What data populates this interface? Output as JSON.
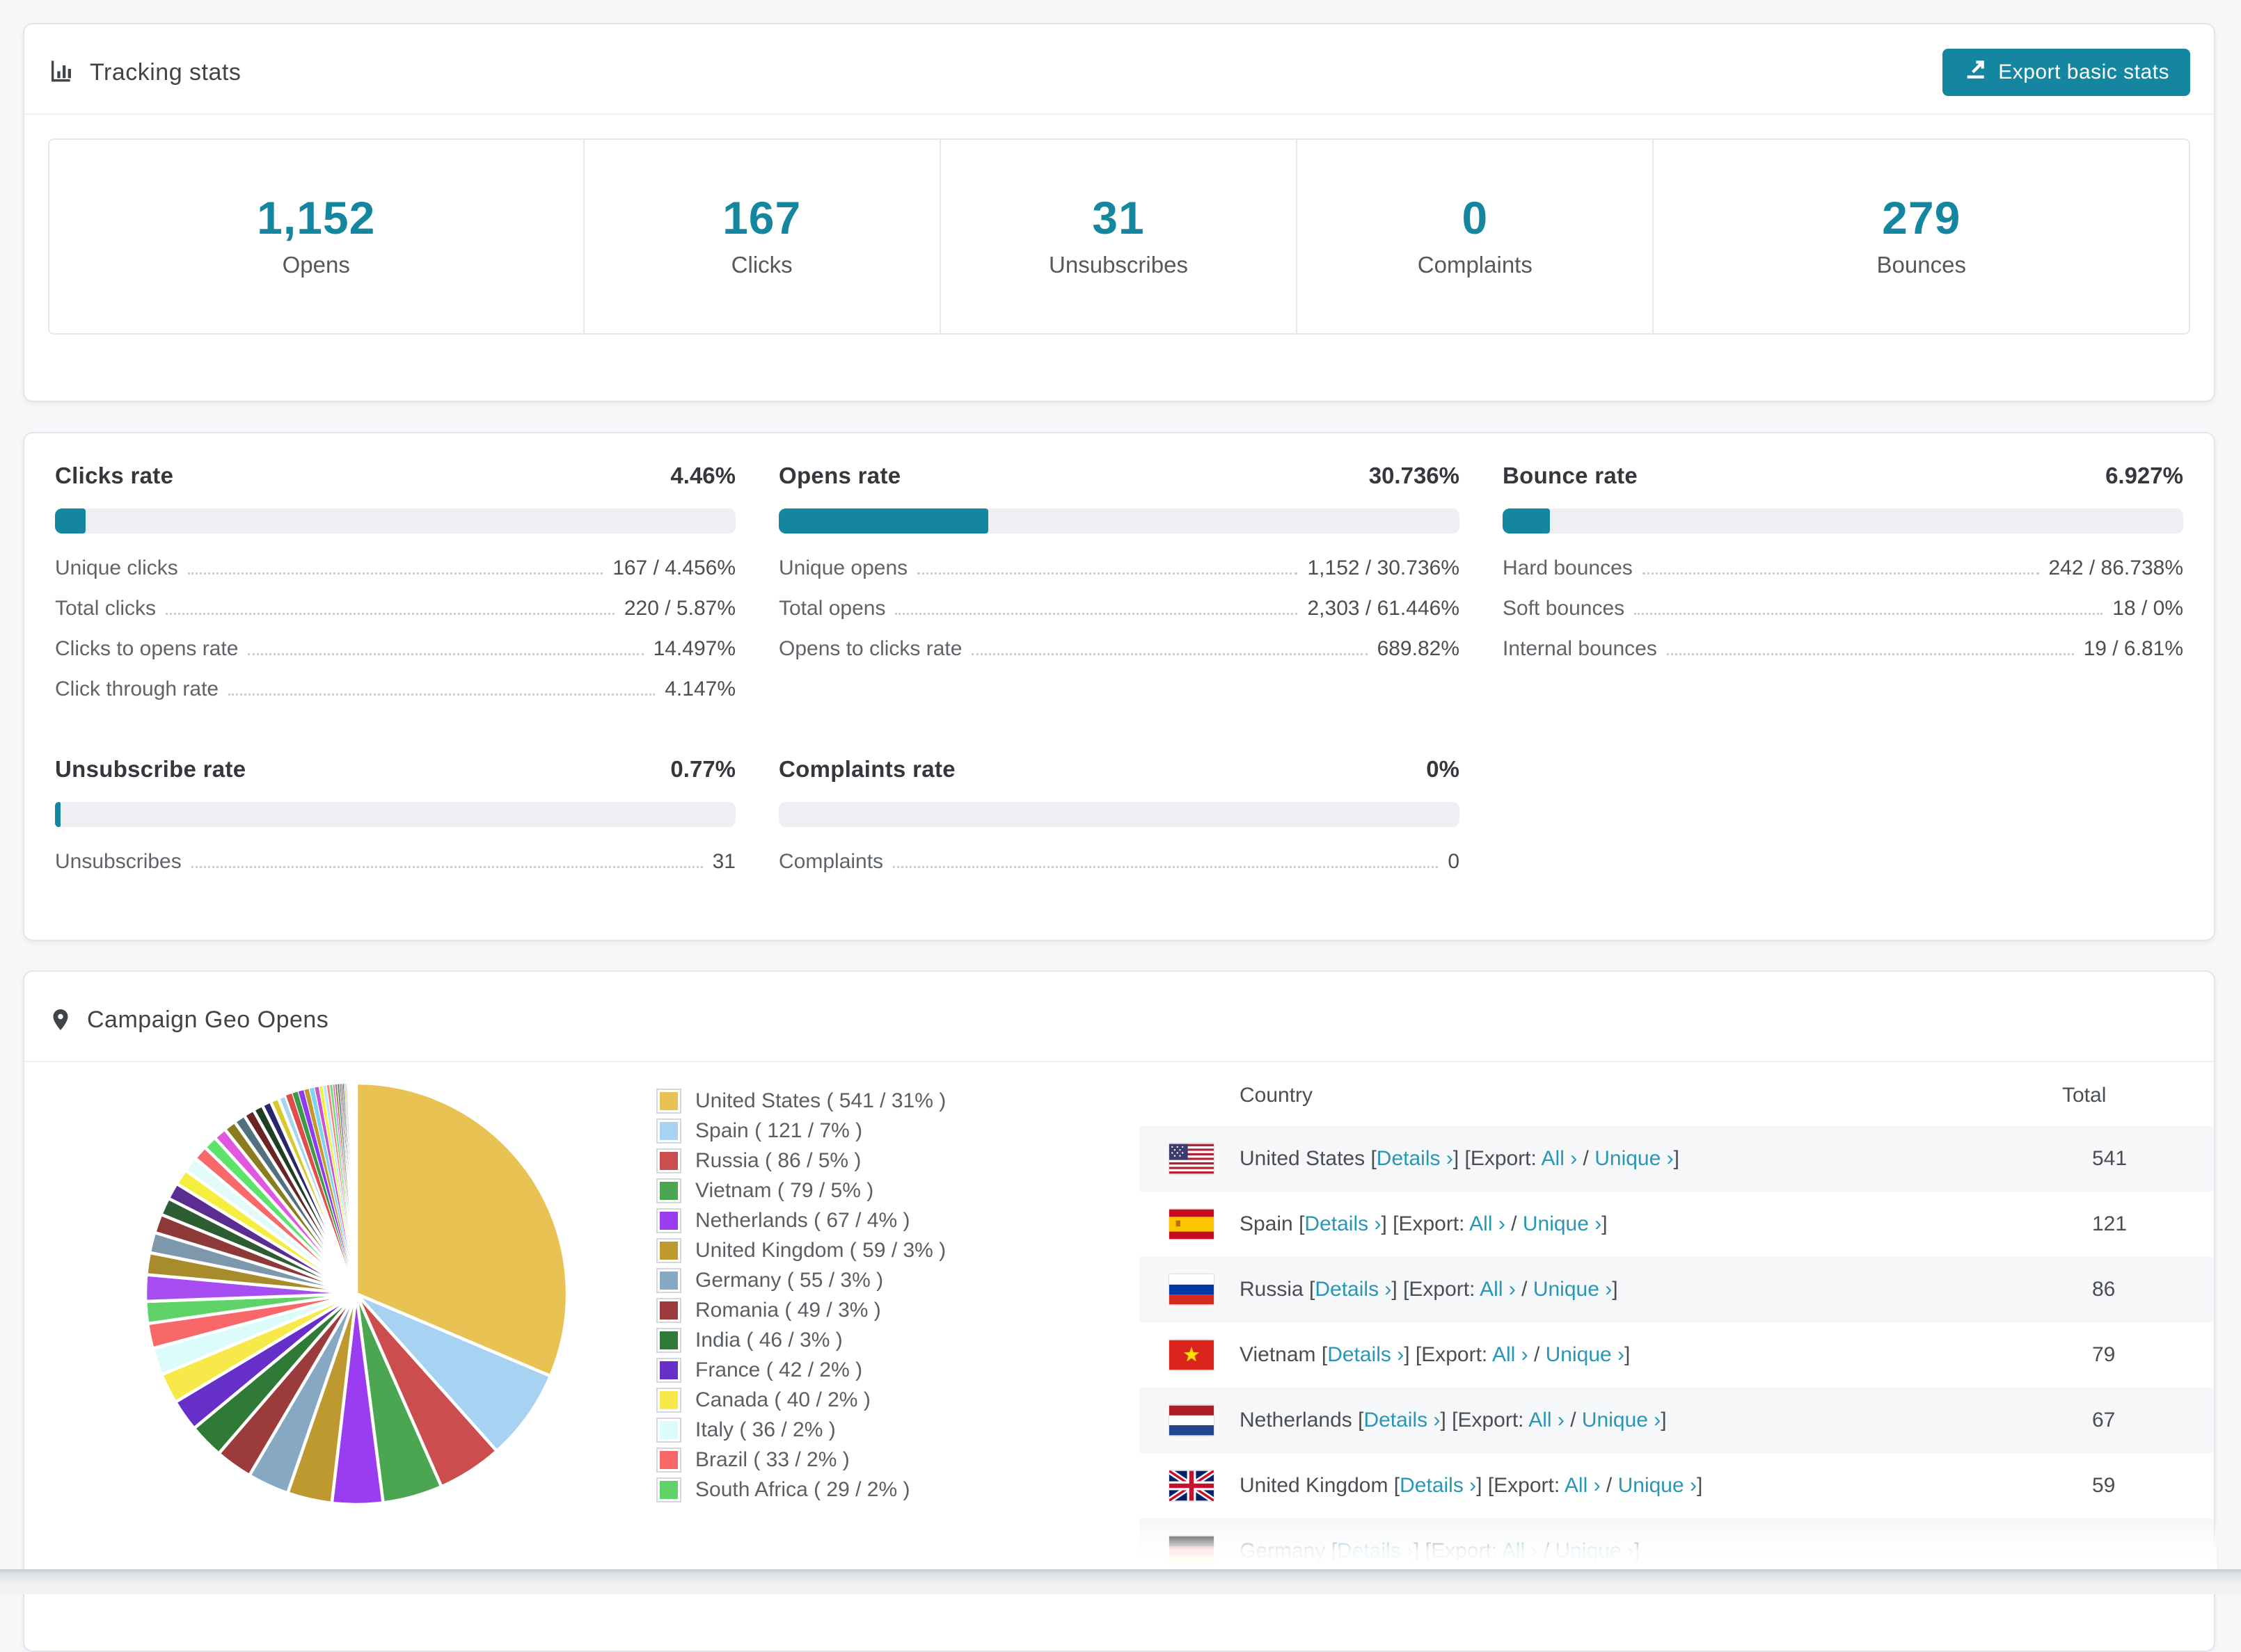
{
  "tracking_card": {
    "title": "Tracking stats",
    "title_icon": "bar-chart-icon",
    "export_button": {
      "label": "Export basic stats",
      "icon": "export-icon",
      "bg": "#1486a0"
    },
    "stats": [
      {
        "value": "1,152",
        "label": "Opens"
      },
      {
        "value": "167",
        "label": "Clicks"
      },
      {
        "value": "31",
        "label": "Unsubscribes"
      },
      {
        "value": "0",
        "label": "Complaints"
      },
      {
        "value": "279",
        "label": "Bounces"
      }
    ]
  },
  "rates_card": {
    "row1": [
      {
        "title": "Clicks rate",
        "value": "4.46%",
        "pct": 4.46,
        "rows": [
          {
            "label": "Unique clicks",
            "value": "167 / 4.456%"
          },
          {
            "label": "Total clicks",
            "value": "220 / 5.87%"
          },
          {
            "label": "Clicks to opens rate",
            "value": "14.497%"
          },
          {
            "label": "Click through rate",
            "value": "4.147%"
          }
        ]
      },
      {
        "title": "Opens rate",
        "value": "30.736%",
        "pct": 30.736,
        "rows": [
          {
            "label": "Unique opens",
            "value": "1,152 / 30.736%"
          },
          {
            "label": "Total opens",
            "value": "2,303 / 61.446%"
          },
          {
            "label": "Opens to clicks rate",
            "value": "689.82%"
          }
        ]
      },
      {
        "title": "Bounce rate",
        "value": "6.927%",
        "pct": 6.927,
        "rows": [
          {
            "label": "Hard bounces",
            "value": "242 / 86.738%"
          },
          {
            "label": "Soft bounces",
            "value": "18 / 0%"
          },
          {
            "label": "Internal bounces",
            "value": "19 / 6.81%"
          }
        ]
      }
    ],
    "row2": [
      {
        "title": "Unsubscribe rate",
        "value": "0.77%",
        "pct": 0.77,
        "rows": [
          {
            "label": "Unsubscribes",
            "value": "31"
          }
        ]
      },
      {
        "title": "Complaints rate",
        "value": "0%",
        "pct": 0,
        "rows": [
          {
            "label": "Complaints",
            "value": "0"
          }
        ]
      }
    ]
  },
  "geo_card": {
    "title": "Campaign Geo Opens",
    "title_icon": "map-pin-icon",
    "table": {
      "headers": {
        "country": "Country",
        "total": "Total"
      },
      "link_details": "Details ›",
      "export_prefix": "Export:",
      "link_all": "All ›",
      "link_unique": "Unique ›",
      "rows": [
        {
          "flag": "us",
          "country": "United States",
          "total": "541"
        },
        {
          "flag": "es",
          "country": "Spain",
          "total": "121"
        },
        {
          "flag": "ru",
          "country": "Russia",
          "total": "86"
        },
        {
          "flag": "vn",
          "country": "Vietnam",
          "total": "79"
        },
        {
          "flag": "nl",
          "country": "Netherlands",
          "total": "67"
        },
        {
          "flag": "gb",
          "country": "United Kingdom",
          "total": "59"
        },
        {
          "flag": "de",
          "country": "Germany",
          "total": "",
          "partial": true
        }
      ]
    }
  },
  "chart_data": {
    "type": "pie",
    "title": "Campaign Geo Opens",
    "legend_position": "right",
    "legend_format": "name ( value / pct )",
    "series": [
      {
        "name": "United States",
        "value": 541,
        "pct": "31%",
        "color": "#e9c254"
      },
      {
        "name": "Spain",
        "value": 121,
        "pct": "7%",
        "color": "#a8d2f2"
      },
      {
        "name": "Russia",
        "value": 86,
        "pct": "5%",
        "color": "#cc4d4d"
      },
      {
        "name": "Vietnam",
        "value": 79,
        "pct": "5%",
        "color": "#4aa650"
      },
      {
        "name": "Netherlands",
        "value": 67,
        "pct": "4%",
        "color": "#9a3df0"
      },
      {
        "name": "United Kingdom",
        "value": 59,
        "pct": "3%",
        "color": "#bd992f"
      },
      {
        "name": "Germany",
        "value": 55,
        "pct": "3%",
        "color": "#87a8c3"
      },
      {
        "name": "Romania",
        "value": 49,
        "pct": "3%",
        "color": "#9c3b3b"
      },
      {
        "name": "India",
        "value": 46,
        "pct": "3%",
        "color": "#2f7a37"
      },
      {
        "name": "France",
        "value": 42,
        "pct": "2%",
        "color": "#6630c8"
      },
      {
        "name": "Canada",
        "value": 40,
        "pct": "2%",
        "color": "#f8e94b"
      },
      {
        "name": "Italy",
        "value": 36,
        "pct": "2%",
        "color": "#dcfcfc"
      },
      {
        "name": "Brazil",
        "value": 33,
        "pct": "2%",
        "color": "#f86868"
      },
      {
        "name": "South Africa",
        "value": 29,
        "pct": "2%",
        "color": "#5fd368"
      }
    ],
    "others_note": "many small unlabeled country slices filling the remainder of the pie",
    "others": {
      "values": [
        35,
        29,
        27,
        25,
        23,
        22,
        21,
        20,
        19,
        18,
        17,
        16,
        15,
        14,
        13,
        12,
        11,
        10,
        9,
        8,
        8,
        7,
        7,
        6,
        5,
        5,
        4,
        4,
        3,
        3,
        3,
        2,
        2,
        2,
        2,
        2,
        1,
        1,
        1,
        1,
        1,
        1,
        1,
        1,
        1,
        1,
        1,
        1
      ],
      "colors": [
        "#a64ef2",
        "#a88b2a",
        "#7d97ad",
        "#8e3939",
        "#2f5d33",
        "#5c2d91",
        "#f6ee3f",
        "#e2fafa",
        "#f86a6a",
        "#5be36a",
        "#e057e0",
        "#8a7d1f",
        "#53707f",
        "#6b2424",
        "#1d3f22",
        "#28276e",
        "#d9c92f",
        "#a9d3ee",
        "#e14b4b",
        "#3f9a46",
        "#8f3bf0",
        "#c2992c",
        "#7fd4f2",
        "#cf4fcf",
        "#f1f13d",
        "#bde9f5",
        "#fb7d7d",
        "#68e373",
        "#e96ae9",
        "#948422",
        "#5d7a88",
        "#79302f",
        "#274c2a",
        "#332e7d",
        "#cbb92e",
        "#98c8ea",
        "#d84545",
        "#51a957",
        "#9b54ef",
        "#b08d2c",
        "#86b6d9",
        "#c04a4a",
        "#3b8f41",
        "#7c3bd4",
        "#e3d43a"
      ]
    }
  }
}
